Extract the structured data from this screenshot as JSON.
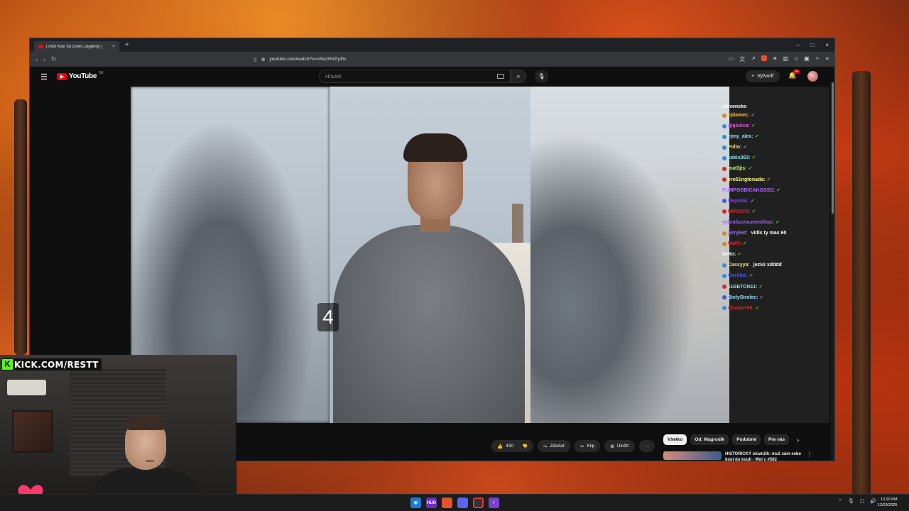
{
  "browser": {
    "tab_title": "(769) Kde Sú Dnes Legendy (",
    "tab_close": "×",
    "new_tab": "+",
    "url": "youtube.com/watch?v=nSwzHVPy3ts",
    "win_min": "–",
    "win_max": "□",
    "win_close": "×"
  },
  "youtube": {
    "logo_text": "YouTube",
    "country_code": "SK",
    "search_placeholder": "Hľadať",
    "create_label": "Vytvoriť",
    "notif_count": "9+"
  },
  "video": {
    "overlay_number": "4"
  },
  "chat": {
    "partial_top": "slovensko",
    "lines": [
      {
        "user": "ejdamec:",
        "color": "#f5c542",
        "badge": "#d38a1c",
        "msg": ""
      },
      {
        "user": "qiqovica:",
        "color": "#e25ed8",
        "badge": "#2b8be3",
        "msg": ""
      },
      {
        "user": "ejmy_alex:",
        "color": "#8fe0ff",
        "badge": "#2b8be3",
        "msg": ""
      },
      {
        "user": "Folto:",
        "color": "#ffe066",
        "badge": "#2b8be3",
        "msg": ""
      },
      {
        "user": "kakis363:",
        "color": "#7ee3e0",
        "badge": "#2b8be3",
        "msg": ""
      },
      {
        "user": "mat3jis:",
        "color": "#b8ff6b",
        "badge": "#d62828",
        "msg": ""
      },
      {
        "user": "ero51ngtonada:",
        "color": "#fffb7a",
        "badge": "#d62828",
        "msg": ""
      },
      {
        "user": "PUMPOSBICAKOSSS:",
        "color": "#b26cff",
        "badge": "",
        "msg": ""
      },
      {
        "user": "Deposki:",
        "color": "#8a3cff",
        "badge": "#3b5bdb",
        "msg": ""
      },
      {
        "user": "MIROOO:",
        "color": "#d62828",
        "badge": "#d62828",
        "msg": ""
      },
      {
        "user": "vyhrafazvuumeshkoz:",
        "color": "#9b5cff",
        "badge": "",
        "msg": ""
      },
      {
        "user": "jerryket:",
        "color": "#a26bff",
        "badge": "#d38a1c",
        "msg": "vidis ty mas 60"
      },
      {
        "user": "Mafif:",
        "color": "#d62828",
        "badge": "#d38a1c",
        "msg": ""
      },
      {
        "user": "heXn:",
        "color": "#ffffff",
        "badge": "",
        "msg": ""
      },
      {
        "user": "Cassyya:",
        "color": "#ffe066",
        "badge": "#2b8be3",
        "msg": "jezisi xdddd"
      },
      {
        "user": "Gorillaz:",
        "color": "#3b5bdb",
        "badge": "#2b8be3",
        "msg": ""
      },
      {
        "user": "11BETON11:",
        "color": "#7ee3e0",
        "badge": "#d62828",
        "msg": ""
      },
      {
        "user": "BielyStrelec:",
        "color": "#8fe0ff",
        "badge": "#3b5bdb",
        "msg": ""
      },
      {
        "user": "Cholder99:",
        "color": "#d62828",
        "badge": "#2b8be3",
        "msg": ""
      }
    ]
  },
  "actions": {
    "like_count": "430",
    "share_label": "Zdieľať",
    "clip_label": "Klip",
    "save_label": "Uložiť",
    "more_label": "···"
  },
  "chips": [
    "Všetko",
    "Od: Magrodik",
    "Podobné",
    "Pre vás"
  ],
  "recommendation": {
    "title": "HISTORICKÝ okamžik: muž sám sebe kopl do koulí - Wel c #582"
  },
  "webcam": {
    "kick_text": "KICK.COM/RESTT"
  },
  "taskbar": {
    "time": "13:20 PM",
    "date": "12/29/2025",
    "app_labels": [
      "",
      "HUD",
      "",
      "",
      "",
      "/"
    ]
  },
  "colors": {
    "accent": "#ff0000",
    "kick_green": "#53fc18",
    "yt_bg": "#0f0f0f"
  }
}
